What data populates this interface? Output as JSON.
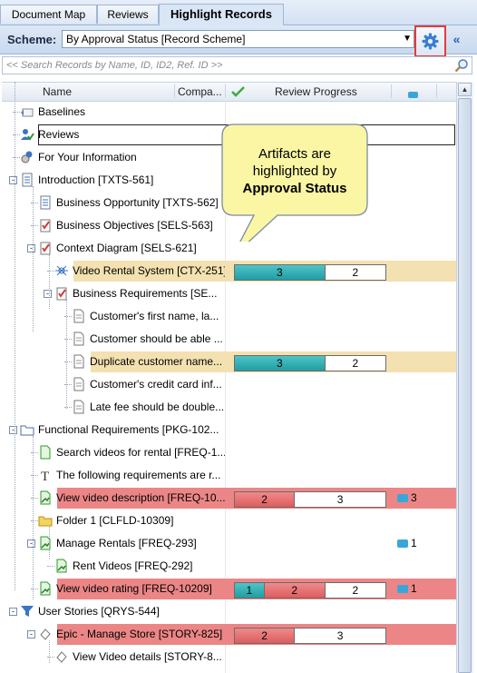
{
  "tabs": [
    "Document Map",
    "Reviews",
    "Highlight Records"
  ],
  "scheme": {
    "label": "Scheme:",
    "value": "By Approval Status [Record Scheme]"
  },
  "search": {
    "placeholder": "<< Search Records by Name, ID, ID2, Ref. ID >>"
  },
  "columns": {
    "name": "Name",
    "compa": "Compa...",
    "progress": "Review Progress"
  },
  "callout": {
    "line1": "Artifacts are",
    "line2": "highlighted by",
    "line3": "Approval Status"
  },
  "rows": [
    {
      "label": "Baselines",
      "icon": "baselines-icon"
    },
    {
      "label": "Reviews",
      "icon": "reviews-icon"
    },
    {
      "label": "For Your Information",
      "icon": "fyi-icon"
    },
    {
      "label": "Introduction [TXTS-561]",
      "icon": "text-document-icon"
    },
    {
      "label": "Business Opportunity [TXTS-562]",
      "icon": "text-document-icon"
    },
    {
      "label": "Business Objectives [SELS-563]",
      "icon": "checklist-icon"
    },
    {
      "label": "Context Diagram [SELS-621]",
      "icon": "checklist-icon"
    },
    {
      "label": "Video Rental System [CTX-251]",
      "icon": "context-icon",
      "highlight": "#f4e1b1",
      "bar": [
        {
          "v": "3",
          "c": "teal"
        },
        {
          "v": "2",
          "c": "white"
        }
      ]
    },
    {
      "label": "Business Requirements [SE...",
      "icon": "checklist-icon"
    },
    {
      "label": "Customer's first name, la...",
      "icon": "document-icon"
    },
    {
      "label": "Customer should be able ...",
      "icon": "document-icon"
    },
    {
      "label": "Duplicate customer name...",
      "icon": "document-icon",
      "highlight": "#f4e1b1",
      "bar": [
        {
          "v": "3",
          "c": "teal"
        },
        {
          "v": "2",
          "c": "white"
        }
      ]
    },
    {
      "label": "Customer's credit card inf...",
      "icon": "document-icon"
    },
    {
      "label": "Late fee should be double...",
      "icon": "document-icon"
    },
    {
      "label": "Functional Requirements [PKG-102...",
      "icon": "folder-package-icon"
    },
    {
      "label": "Search videos for rental [FREQ-1...",
      "icon": "requirement-icon"
    },
    {
      "label": "The following requirements are r...",
      "icon": "text-icon"
    },
    {
      "label": "View video description [FREQ-10...",
      "icon": "requirement-approved-icon",
      "highlight": "#ec8686",
      "bar": [
        {
          "v": "2",
          "c": "red"
        },
        {
          "v": "3",
          "c": "white"
        }
      ],
      "comments": "3"
    },
    {
      "label": "Folder 1 [CLFLD-10309]",
      "icon": "folder-icon"
    },
    {
      "label": "Manage Rentals [FREQ-293]",
      "icon": "requirement-approved-icon",
      "comments": "1"
    },
    {
      "label": "Rent Videos [FREQ-292]",
      "icon": "requirement-approved-icon"
    },
    {
      "label": "View video rating [FREQ-10209]",
      "icon": "requirement-approved-icon",
      "highlight": "#ec8686",
      "bar": [
        {
          "v": "1",
          "c": "teal"
        },
        {
          "v": "2",
          "c": "red"
        },
        {
          "v": "2",
          "c": "white"
        }
      ],
      "comments": "1"
    },
    {
      "label": "User Stories [QRYS-544]",
      "icon": "filter-icon"
    },
    {
      "label": "Epic - Manage Store [STORY-825]",
      "icon": "story-icon",
      "highlight": "#ec8686",
      "bar": [
        {
          "v": "2",
          "c": "red"
        },
        {
          "v": "3",
          "c": "white"
        }
      ]
    },
    {
      "label": "View Video details [STORY-8...",
      "icon": "story-icon"
    }
  ],
  "colors": {
    "teal": "#23a0a5",
    "red": "#e06262",
    "tan": "#f4e1b1",
    "accent_border": "#e53b3b"
  }
}
